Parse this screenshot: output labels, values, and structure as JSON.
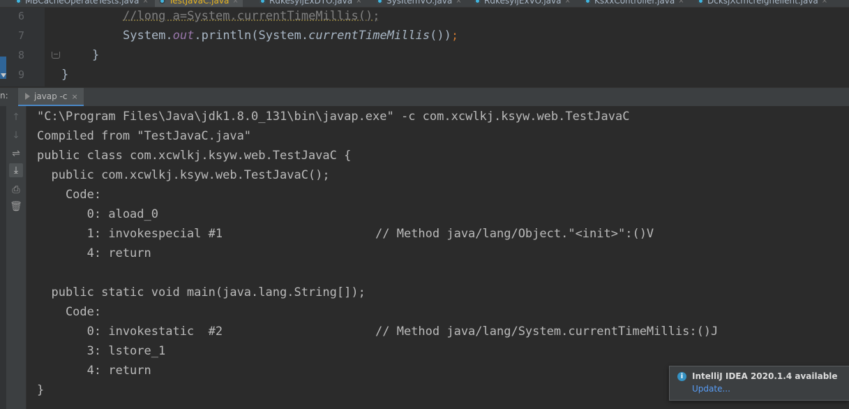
{
  "file_tabs": [
    {
      "name": "MBCacheOperateTests.java",
      "active": false
    },
    {
      "name": "TestJavaC.java",
      "active": true
    },
    {
      "name": "RdkesyljExDTO.java",
      "active": false
    },
    {
      "name": "SysItemVO.java",
      "active": false
    },
    {
      "name": "RdkesyljExVO.java",
      "active": false
    },
    {
      "name": "KsxxController.java",
      "active": false
    },
    {
      "name": "DcksjXcmcrelgnelient.java",
      "active": false
    }
  ],
  "editor": {
    "line_numbers": [
      "6",
      "7",
      "8",
      "9"
    ],
    "lines": {
      "line6": "//long a=System.currentTimeMillis();",
      "line7_a": "System.",
      "line7_b": "out",
      "line7_c": ".println(System.",
      "line7_d": "currentTimeMillis",
      "line7_e": "())",
      "line7_f": ";",
      "line8": "}",
      "line9": "}"
    }
  },
  "run_window": {
    "label": "n:",
    "tab_label": "javap -c",
    "close_glyph": "×"
  },
  "console_lines": [
    "\"C:\\Program Files\\Java\\jdk1.8.0_131\\bin\\javap.exe\" -c com.xcwlkj.ksyw.web.TestJavaC",
    "Compiled from \"TestJavaC.java\"",
    "public class com.xcwlkj.ksyw.web.TestJavaC {",
    "  public com.xcwlkj.ksyw.web.TestJavaC();",
    "    Code:",
    "       0: aload_0",
    "       1: invokespecial #1",
    "       4: return",
    "",
    "  public static void main(java.lang.String[]);",
    "    Code:",
    "       0: invokestatic  #2",
    "       3: lstore_1",
    "       4: return",
    "}"
  ],
  "console_comments": {
    "init": "// Method java/lang/Object.\"<init>\":()V",
    "time": "// Method java/lang/System.currentTimeMillis:()J"
  },
  "tool_icons": [
    "arrow-up-icon",
    "arrow-down-icon",
    "soft-wrap-icon",
    "scroll-to-end-icon",
    "print-icon",
    "trash-icon"
  ],
  "notification": {
    "title": "IntelliJ IDEA 2020.1.4 available",
    "link": "Update..."
  },
  "colors": {
    "background": "#2b2b2b",
    "accent": "#4a88c7",
    "link": "#589df6"
  }
}
